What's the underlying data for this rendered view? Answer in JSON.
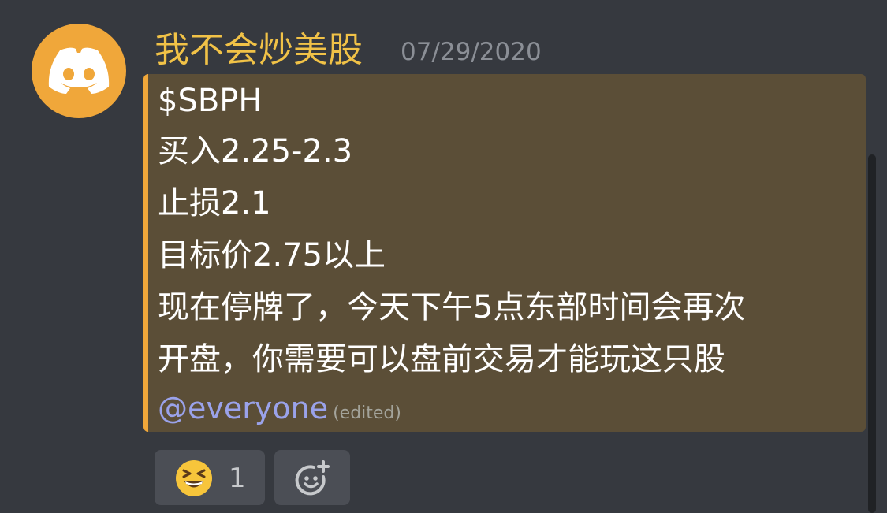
{
  "message": {
    "author": "我不会炒美股",
    "timestamp": "07/29/2020",
    "lines": [
      "$SBPH",
      "买入2.25-2.3",
      "止损2.1",
      "目标价2.75以上",
      "现在停牌了，今天下午5点东部时间会再次",
      "开盘，你需要可以盘前交易才能玩这只股"
    ],
    "mention": "@everyone",
    "edited": "(edited)"
  },
  "reactions": [
    {
      "emoji": "grinning-squinting-face",
      "count": "1"
    }
  ],
  "icons": {
    "avatar": "discord-logo-icon",
    "add_reaction": "add-reaction-icon"
  },
  "colors": {
    "background": "#36393f",
    "author": "#f1c247",
    "timestamp": "#8b8f96",
    "message_box": "#5b4e37",
    "accent": "#f0a73a",
    "mention": "#9aa2ea",
    "reaction_bg": "#4b4e55"
  }
}
